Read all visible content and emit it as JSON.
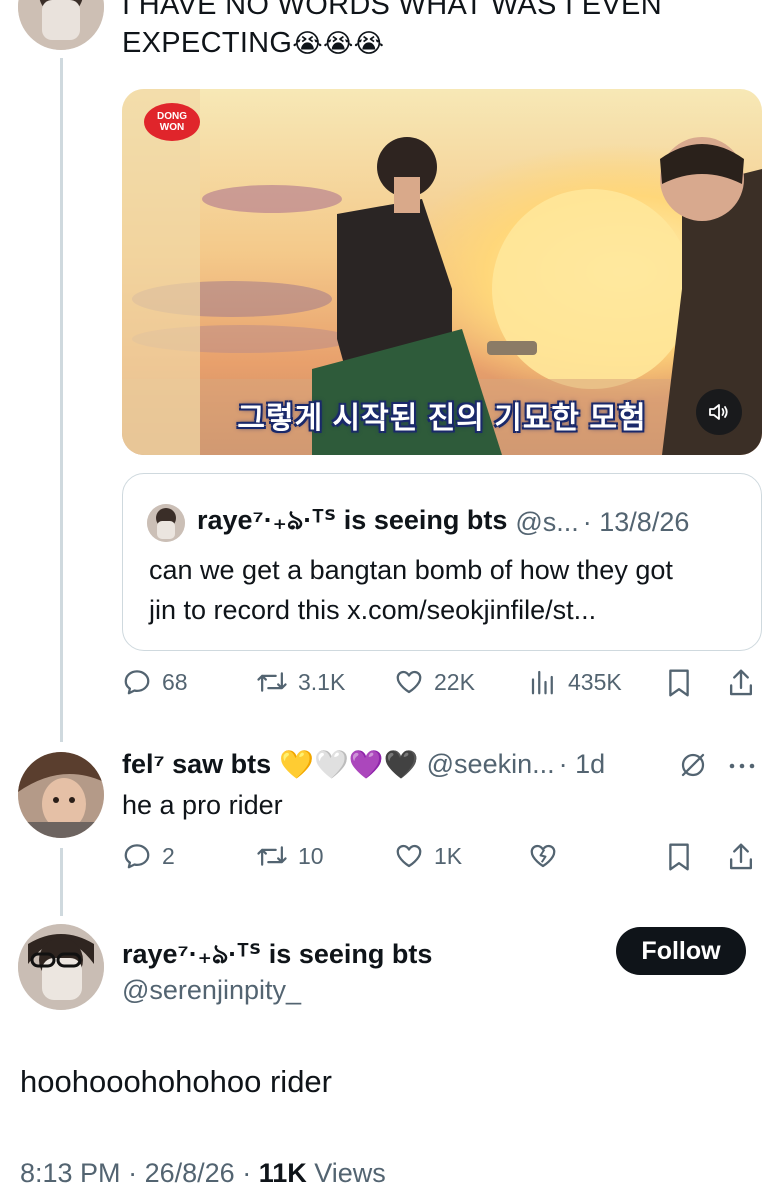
{
  "parent_tweet": {
    "text_line1": "I HAVE NO WORDS WHAT WAS I EVEN",
    "text_line2": "EXPECTING",
    "text_emojis": "😭😭😭",
    "media": {
      "logo_text": "DONG WON",
      "subtitle": "그렇게 시작된 진의 기묘한 모험",
      "sound_icon": "speaker-icon"
    },
    "quote": {
      "name": "raye⁷·₊ঌ·ᵀᔆ is seeing bts",
      "handle": "@s...",
      "date": "· 13/8/26",
      "text_line1": "can we get a bangtan bomb of how they got",
      "text_line2": "jin to record this x.com/seokjinfile/st..."
    },
    "actions": {
      "replies": "68",
      "reposts": "3.1K",
      "likes": "22K",
      "views": "435K"
    }
  },
  "reply_tweet": {
    "name": "fel⁷ saw bts",
    "hearts": "💛🤍💜🖤",
    "handle": "@seekin...",
    "date": "· 1d",
    "text": "he a pro rider",
    "actions": {
      "replies": "2",
      "reposts": "10",
      "likes": "1K"
    }
  },
  "main_tweet": {
    "name": "raye⁷·₊ঌ·ᵀᔆ is seeing bts",
    "handle": "@serenjinpity_",
    "follow_label": "Follow",
    "text": "hoohooohohohoo rider",
    "time": "8:13 PM",
    "date": "26/8/26",
    "views_count": "11K",
    "views_label": "Views"
  },
  "colors": {
    "text_primary": "#0f1419",
    "text_secondary": "#536471",
    "border": "#cfd9de",
    "follow_bg": "#0f1419"
  }
}
